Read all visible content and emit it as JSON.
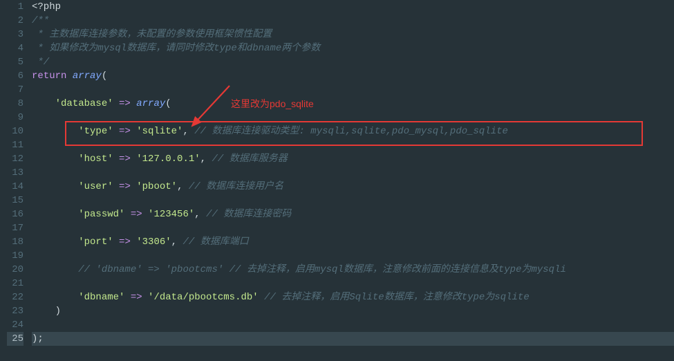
{
  "gutter": {
    "lines": [
      "1",
      "2",
      "3",
      "4",
      "5",
      "6",
      "7",
      "8",
      "9",
      "10",
      "11",
      "12",
      "13",
      "14",
      "15",
      "16",
      "17",
      "18",
      "19",
      "20",
      "21",
      "22",
      "23",
      "24",
      "25"
    ],
    "active_line": 25
  },
  "code": {
    "l1_phptag": "<?php",
    "l2_c": "/**",
    "l3_c": " * 主数据库连接参数，未配置的参数使用框架惯性配置",
    "l4_c": " * 如果修改为mysql数据库，请同时修改type和dbname两个参数",
    "l5_c": " */",
    "l6_return": "return",
    "l6_array": "array",
    "l6_paren": "(",
    "l8_key": "'database'",
    "l8_arrow": " => ",
    "l8_array": "array",
    "l8_paren": "(",
    "l10_key": "'type'",
    "l10_arrow": " => ",
    "l10_val": "'sqlite'",
    "l10_comma": ", ",
    "l10_comment": "// 数据库连接驱动类型: mysqli,sqlite,pdo_mysql,pdo_sqlite",
    "l12_key": "'host'",
    "l12_arrow": " => ",
    "l12_val": "'127.0.0.1'",
    "l12_comma": ", ",
    "l12_comment": "// 数据库服务器",
    "l14_key": "'user'",
    "l14_arrow": " => ",
    "l14_val": "'pboot'",
    "l14_comma": ", ",
    "l14_comment": "// 数据库连接用户名",
    "l16_key": "'passwd'",
    "l16_arrow": " => ",
    "l16_val": "'123456'",
    "l16_comma": ", ",
    "l16_comment": "// 数据库连接密码",
    "l18_key": "'port'",
    "l18_arrow": " => ",
    "l18_val": "'3306'",
    "l18_comma": ", ",
    "l18_comment": "// 数据库端口",
    "l20_comment": "// 'dbname' => 'pbootcms' // 去掉注释，启用mysql数据库，注意修改前面的连接信息及type为mysqli",
    "l22_key": "'dbname'",
    "l22_arrow": " => ",
    "l22_val": "'/data/pbootcms.db'",
    "l22_space": " ",
    "l22_comment": "// 去掉注释，启用Sqlite数据库，注意修改type为sqlite",
    "l23_paren": ")",
    "l25_close": ");"
  },
  "annotation": {
    "text": "这里改为pdo_sqlite"
  },
  "highlight": {
    "target_line": 10
  },
  "colors": {
    "annotation": "#e53935",
    "background": "#263238"
  }
}
